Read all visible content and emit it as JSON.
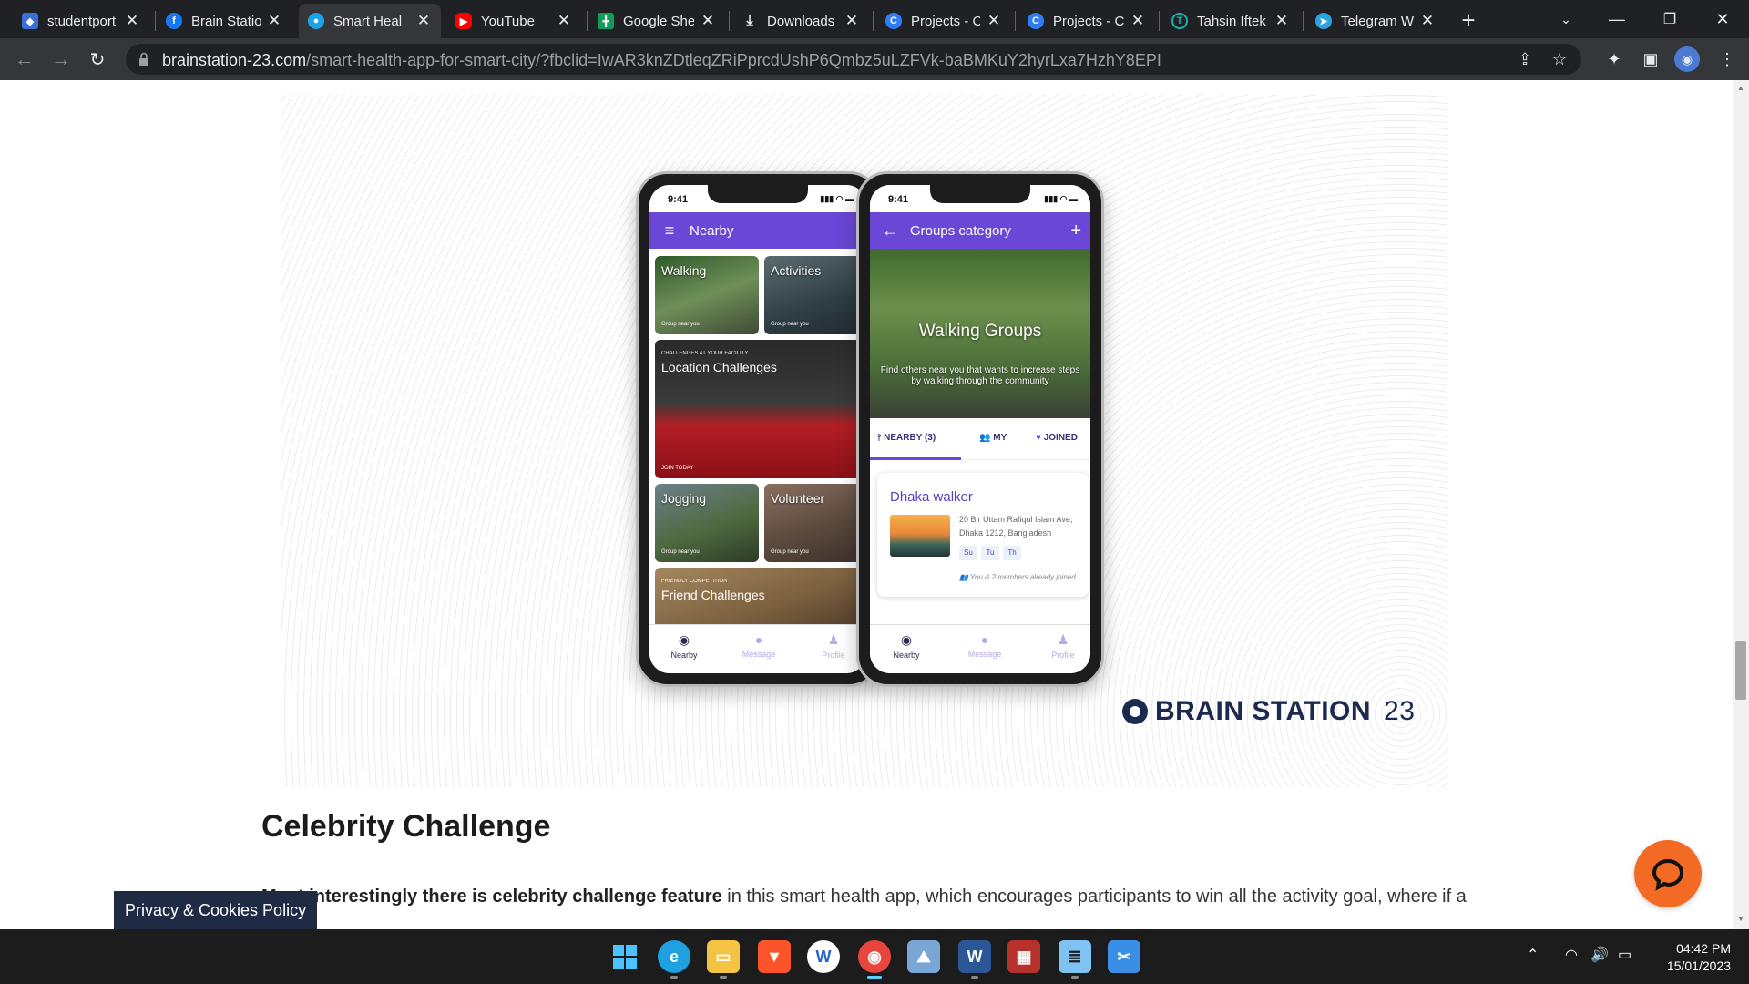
{
  "browser": {
    "tabs": [
      {
        "title": "studentport",
        "icon": "studentportal-icon",
        "color": "#3b6fd8",
        "active": false
      },
      {
        "title": "Brain Statio",
        "icon": "facebook-icon",
        "color": "#1877f2",
        "active": false
      },
      {
        "title": "Smart Heal",
        "icon": "brainstation-icon",
        "color": "#1aa3e8",
        "active": true
      },
      {
        "title": "YouTube",
        "icon": "youtube-icon",
        "color": "#ff0000",
        "active": false
      },
      {
        "title": "Google She",
        "icon": "google-sheets-icon",
        "color": "#0f9d58",
        "active": false
      },
      {
        "title": "Downloads",
        "icon": "download-icon",
        "color": "#e8eaed",
        "active": false
      },
      {
        "title": "Projects - C",
        "icon": "canva-icon",
        "color": "#2f7df6",
        "active": false
      },
      {
        "title": "Projects - C",
        "icon": "canva-icon",
        "color": "#2f7df6",
        "active": false
      },
      {
        "title": "Tahsin Iftek",
        "icon": "shield-icon",
        "color": "#12b5a8",
        "active": false
      },
      {
        "title": "Telegram W",
        "icon": "telegram-icon",
        "color": "#2aa3e0",
        "active": false
      }
    ],
    "url_host": "brainstation-23.com",
    "url_path": "/smart-health-app-for-smart-city/?fbclid=IwAR3knZDtleqZRiPprcdUshP6Qmbz5uLZFVk-baBMKuY2hyrLxa7HzhY8EPI"
  },
  "phone_left": {
    "time": "9:41",
    "title": "Nearby",
    "cards": [
      {
        "title": "Walking",
        "subtitle": "Group near you"
      },
      {
        "title": "Activities",
        "subtitle": "Group near you"
      },
      {
        "pre": "CHALLENGES AT YOUR FACILITY",
        "title": "Location Challenges",
        "subtitle": "JOIN TODAY"
      },
      {
        "title": "Jogging",
        "subtitle": "Group near you"
      },
      {
        "title": "Volunteer",
        "subtitle": "Group near you"
      },
      {
        "pre": "FRIENDLY COMPETITION",
        "title": "Friend Challenges"
      }
    ],
    "nav": [
      "Nearby",
      "Message",
      "Profile"
    ]
  },
  "phone_right": {
    "time": "9:41",
    "title": "Groups category",
    "header_title": "Walking Groups",
    "header_desc": "Find others near you that wants to increase steps by walking through the community",
    "tabs": [
      "NEARBY (3)",
      "MY",
      "JOINED"
    ],
    "group": {
      "name": "Dhaka walker",
      "address_line1": "20 Bir Uttam Rafiqul Islam Ave,",
      "address_line2": "Dhaka 1212, Bangladesh",
      "days": [
        "Su",
        "Tu",
        "Th"
      ],
      "members": "You & 2 members already joined."
    },
    "nav": [
      "Nearby",
      "Message",
      "Profile"
    ]
  },
  "brand": {
    "name": "BRAIN STATION",
    "number": "23"
  },
  "article": {
    "heading": "Celebrity Challenge",
    "para_bold": "Most interestingly there is celebrity challenge feature",
    "para_rest": " in this smart health app, which encourages participants to win all the activity goal, where if a"
  },
  "privacy_label": "Privacy & Cookies Policy",
  "taskbar": {
    "apps": [
      {
        "name": "windows-start-icon",
        "color": "#4cc2ff"
      },
      {
        "name": "edge-icon",
        "color": "#1fa0e0"
      },
      {
        "name": "file-explorer-icon",
        "color": "#f5c342"
      },
      {
        "name": "brave-icon",
        "color": "#fb542b"
      },
      {
        "name": "app-w-icon",
        "color": "#2a64c6"
      },
      {
        "name": "chrome-icon",
        "color": "#e8453c"
      },
      {
        "name": "photos-icon",
        "color": "#7aa6d6"
      },
      {
        "name": "word-icon",
        "color": "#2b5797"
      },
      {
        "name": "winrar-icon",
        "color": "#b7312c"
      },
      {
        "name": "notepad-icon",
        "color": "#7fc3f2"
      },
      {
        "name": "snipping-tool-icon",
        "color": "#3a8ee6"
      }
    ],
    "time": "04:42 PM",
    "date": "15/01/2023"
  }
}
